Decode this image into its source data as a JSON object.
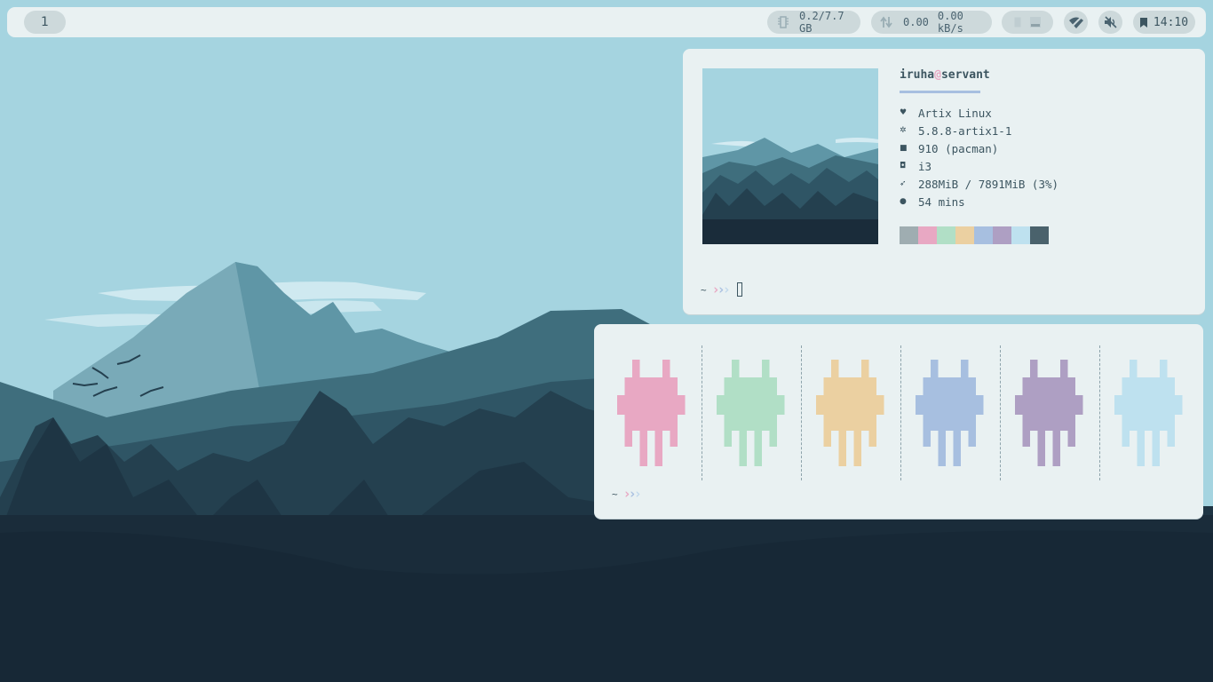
{
  "topbar": {
    "workspace": "1",
    "memory": "0.2/7.7 GB",
    "net_down": "0.00",
    "net_up": "0.00 kB/s",
    "clock": "14:10"
  },
  "fetch": {
    "user": "iruha",
    "at": "@",
    "host": "servant",
    "rows": [
      {
        "icon": "heart-icon",
        "glyph": "♥",
        "value": "Artix Linux"
      },
      {
        "icon": "gear-icon",
        "glyph": "✲",
        "value": "5.8.8-artix1-1"
      },
      {
        "icon": "package-icon",
        "glyph": "■",
        "value": "910 (pacman)"
      },
      {
        "icon": "window-icon",
        "glyph": "◘",
        "value": "i3"
      },
      {
        "icon": "feather-icon",
        "glyph": "➶",
        "value": "288MiB / 7891MiB (3%)"
      },
      {
        "icon": "bulb-icon",
        "glyph": "●",
        "value": "54 mins"
      }
    ],
    "palette": [
      "#9fadb1",
      "#e8a8c3",
      "#b1dfc6",
      "#ebd0a1",
      "#a7bfe0",
      "#ae9fc3",
      "#bee1ef",
      "#4a626c"
    ]
  },
  "prompt": {
    "tilde": "~"
  },
  "invaders": {
    "colors": [
      "#e8a8c3",
      "#b1dfc6",
      "#ebd0a1",
      "#a7bfe0",
      "#ae9fc3",
      "#bee1ef"
    ]
  }
}
